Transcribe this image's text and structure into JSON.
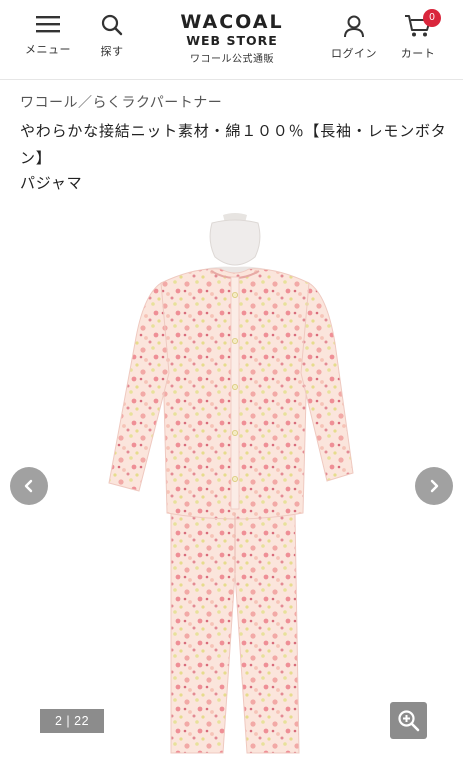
{
  "header": {
    "menu_label": "メニュー",
    "search_label": "探す",
    "logo_brand": "WACOAL",
    "logo_store": "WEB STORE",
    "logo_sub": "ワコール公式通販",
    "login_label": "ログイン",
    "cart_label": "カート",
    "cart_count": "0",
    "badge_color": "#d9263c"
  },
  "product": {
    "brand_line": "ワコール／らくラクパートナー",
    "title": "やわらかな接結ニット素材・綿１００％【長袖・レモンボタン】",
    "type": "パジャマ"
  },
  "gallery": {
    "counter": "2 | 22",
    "current": 2,
    "total": 22
  },
  "icons": {
    "menu": "hamburger-icon",
    "search": "search-icon",
    "login": "user-icon",
    "cart": "cart-icon",
    "prev": "chevron-left-icon",
    "next": "chevron-right-icon",
    "zoom": "zoom-in-icon"
  }
}
